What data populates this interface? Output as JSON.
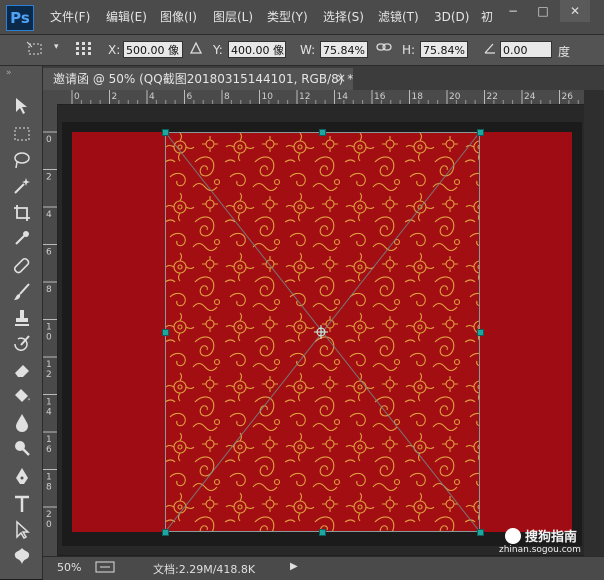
{
  "app": {
    "logo_text": "Ps"
  },
  "menu": {
    "items": [
      "文件(F)",
      "编辑(E)",
      "图像(I)",
      "图层(L)",
      "类型(Y)",
      "选择(S)",
      "滤镜(T)",
      "3D(D)",
      "初"
    ]
  },
  "window_controls": {
    "minimize": "−",
    "restore": "□",
    "close": "✕"
  },
  "options": {
    "x_label": "X:",
    "x_value": "500.00 像",
    "y_label": "Y:",
    "y_value": "400.00 像",
    "w_label": "W:",
    "w_value": "75.84%",
    "h_label": "H:",
    "h_value": "75.84%",
    "angle_value": "0.00",
    "angle_unit": "度"
  },
  "document_tab": {
    "title": "邀请函 @ 50% (QQ截图20180315144101, RGB/8) *",
    "close": "×"
  },
  "ruler": {
    "top_ticks": [
      "0",
      "2",
      "4",
      "6",
      "8",
      "10",
      "12",
      "14",
      "16",
      "18",
      "20",
      "22",
      "24",
      "26"
    ],
    "left_ticks": [
      "0",
      "2",
      "4",
      "6",
      "8",
      "10",
      "12",
      "14",
      "16",
      "18",
      "20"
    ]
  },
  "status": {
    "zoom": "50%",
    "doc_info": "文档:2.29M/418.8K",
    "arrow": "▶"
  },
  "watermark": {
    "brand": "搜狗指南",
    "url": "zhinan.sogou.com"
  },
  "colors": {
    "canvas_red": "#a00c13",
    "pattern_gold": "#e0a040",
    "handle": "#1ea7a0"
  }
}
